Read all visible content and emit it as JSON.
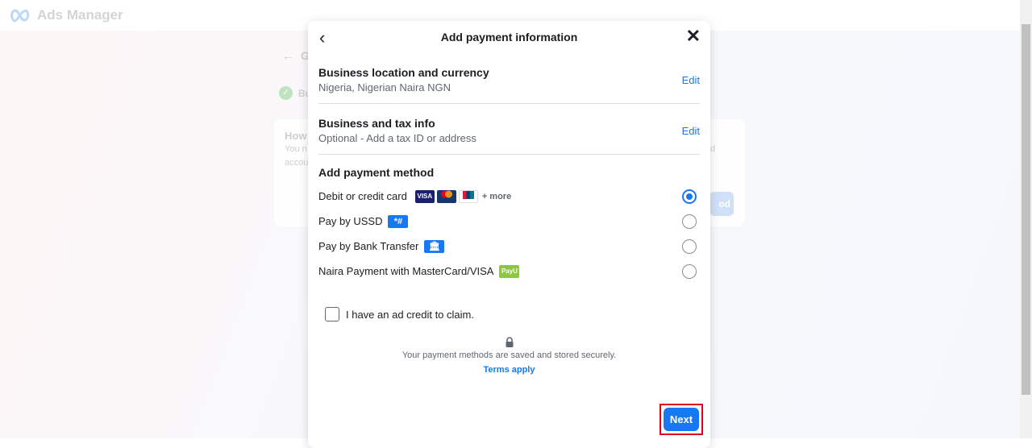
{
  "app": {
    "title": "Ads Manager"
  },
  "background": {
    "back_fragment": "G",
    "step_fragment": "Bu",
    "card_title_fragment": "How",
    "card_line1_fragment": "You n",
    "card_line2_fragment": "accou",
    "card_right_fragment": "d",
    "button_fragment": "od"
  },
  "modal": {
    "title": "Add payment information",
    "sections": [
      {
        "title": "Business location and currency",
        "value": "Nigeria, Nigerian Naira NGN",
        "edit": "Edit"
      },
      {
        "title": "Business and tax info",
        "value": "Optional - Add a tax ID or address",
        "edit": "Edit"
      }
    ],
    "payment": {
      "title": "Add payment method",
      "methods": [
        {
          "label": "Debit or credit card",
          "icons": [
            "VISA",
            "mastercard",
            "unionpay"
          ],
          "more": "+ more",
          "selected": true
        },
        {
          "label": "Pay by USSD",
          "icon": "*#",
          "selected": false
        },
        {
          "label": "Pay by Bank Transfer",
          "icon": "bank-transfer",
          "selected": false
        },
        {
          "label": "Naira Payment with MasterCard/VISA",
          "icon": "PayU",
          "selected": false
        }
      ]
    },
    "credit_checkbox": {
      "label": "I have an ad credit to claim.",
      "checked": false
    },
    "secure_note": "Your payment methods are saved and stored securely.",
    "terms": "Terms apply",
    "next": "Next"
  },
  "colors": {
    "accent": "#1877f2",
    "highlight": "#e0001b"
  }
}
